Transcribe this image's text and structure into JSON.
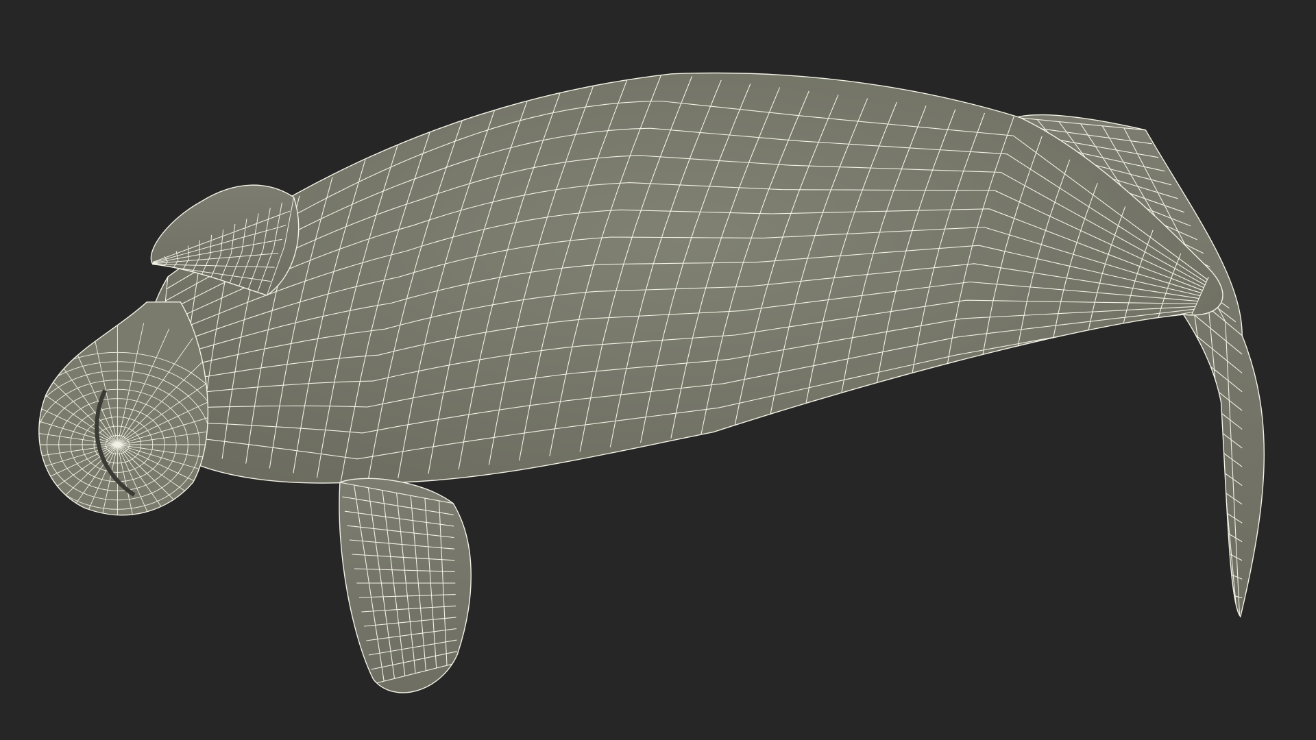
{
  "scene": {
    "subject": "manatee-wireframe-model",
    "background_color": "#262626",
    "mesh_fill_color": "#7b7c6e",
    "mesh_shade_color": "#6a6b5e",
    "wire_color": "#f3f2e6"
  }
}
